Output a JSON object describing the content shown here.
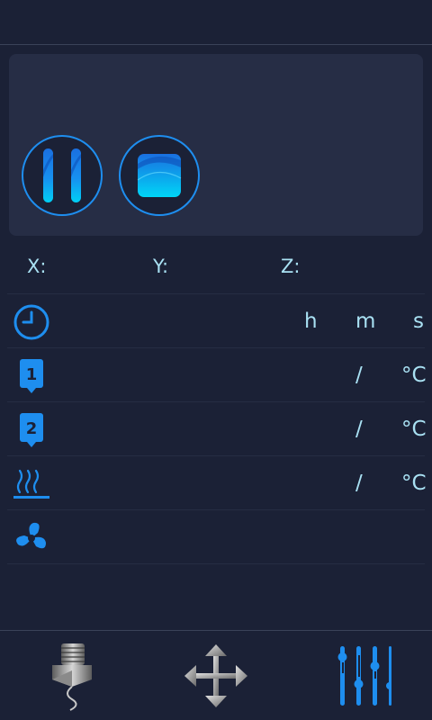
{
  "header": {
    "title": ""
  },
  "job": {
    "file_name": "",
    "pause_label": "pause",
    "stop_label": "stop"
  },
  "position": {
    "x_label": "X:",
    "x_value": "",
    "y_label": "Y:",
    "y_value": "",
    "z_label": "Z:",
    "z_value": ""
  },
  "time": {
    "icon": "clock-icon",
    "hours": "",
    "h_unit": "h",
    "minutes": "",
    "m_unit": "m",
    "seconds": "",
    "s_unit": "s"
  },
  "extruder1": {
    "icon": "nozzle-1-icon",
    "badge": "1",
    "current": "",
    "separator": "/",
    "target": "",
    "unit": "°C"
  },
  "extruder2": {
    "icon": "nozzle-2-icon",
    "badge": "2",
    "current": "",
    "separator": "/",
    "target": "",
    "unit": "°C"
  },
  "bed": {
    "icon": "heated-bed-icon",
    "current": "",
    "separator": "/",
    "target": "",
    "unit": "°C"
  },
  "fan": {
    "icon": "fan-icon",
    "speed": ""
  },
  "bottom_nav": [
    {
      "name": "extrude",
      "icon": "extruder-icon"
    },
    {
      "name": "move",
      "icon": "move-arrows-icon"
    },
    {
      "name": "settings",
      "icon": "sliders-icon"
    }
  ],
  "colors": {
    "background": "#1b2136",
    "panel": "#262d45",
    "accent": "#1e8eef",
    "text": "#a9e1f3"
  }
}
